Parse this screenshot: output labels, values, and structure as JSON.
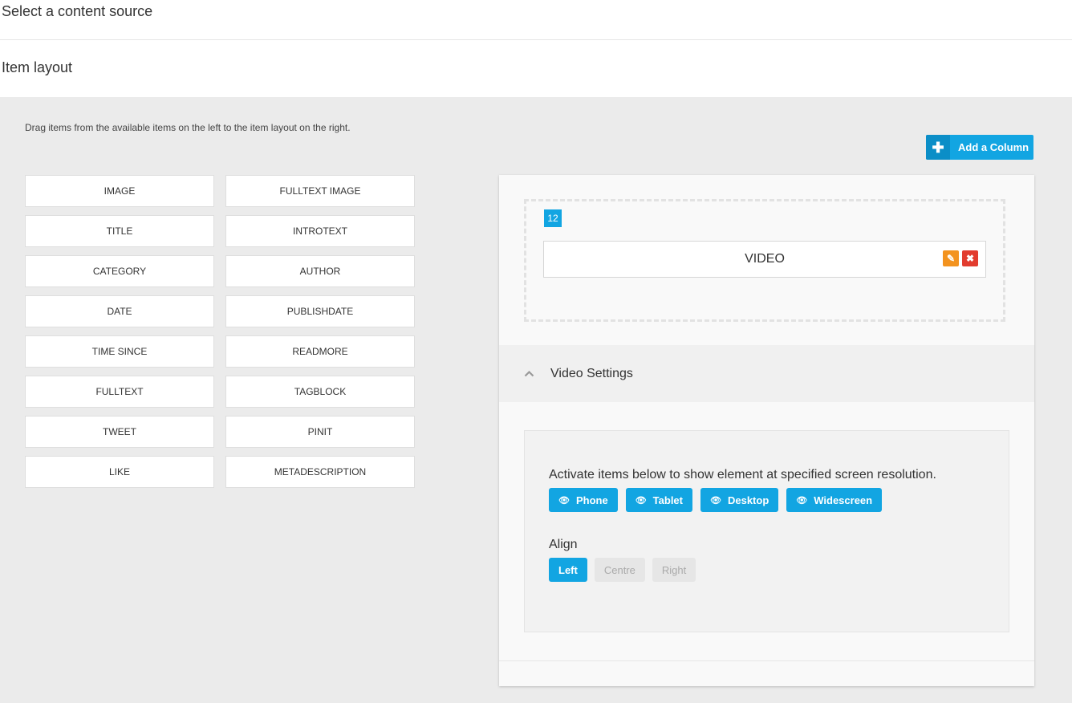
{
  "sections": {
    "content_source": "Select a content source",
    "item_layout": "Item layout"
  },
  "help_text": "Drag items from the available items on the left to the item layout on the right.",
  "add_column": {
    "icon": "plus-icon",
    "label": "Add a Column"
  },
  "available_items": [
    "IMAGE",
    "FULLTEXT IMAGE",
    "TITLE",
    "INTROTEXT",
    "CATEGORY",
    "AUTHOR",
    "DATE",
    "PUBLISHDATE",
    "TIME SINCE",
    "READMORE",
    "FULLTEXT",
    "TAGBLOCK",
    "TWEET",
    "PINIT",
    "LIKE",
    "METADESCRIPTION"
  ],
  "layout": {
    "column_size": "12",
    "placed_item": "VIDEO",
    "edit_icon": "pencil-icon",
    "delete_icon": "close-icon"
  },
  "settings": {
    "title": "Video Settings",
    "toggle_icon": "chevron-up-icon",
    "description": "Activate items below to show element at specified screen resolution.",
    "visibility_buttons": [
      "Phone",
      "Tablet",
      "Desktop",
      "Widescreen"
    ],
    "visibility_icon": "eye-icon",
    "align_label": "Align",
    "align_options": [
      "Left",
      "Centre",
      "Right"
    ],
    "align_selected": "Left"
  },
  "colors": {
    "accent": "#12a5e2",
    "edit": "#f3931f",
    "delete": "#e23c2f"
  }
}
